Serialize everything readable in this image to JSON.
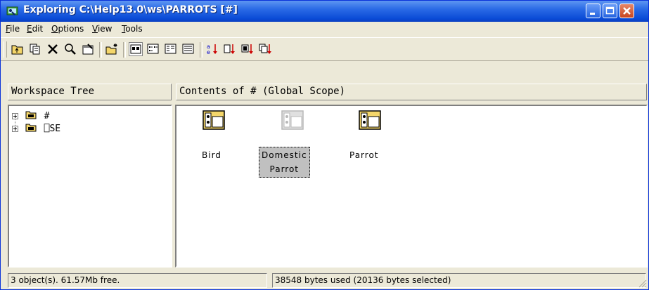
{
  "window": {
    "title": "Exploring C:\\Help13.0\\ws\\PARROTS [#]"
  },
  "menu": [
    {
      "label_pre": "",
      "mnemonic": "F",
      "label_post": "ile"
    },
    {
      "label_pre": "",
      "mnemonic": "E",
      "label_post": "dit"
    },
    {
      "label_pre": "",
      "mnemonic": "O",
      "label_post": "ptions"
    },
    {
      "label_pre": "",
      "mnemonic": "V",
      "label_post": "iew"
    },
    {
      "label_pre": "",
      "mnemonic": "T",
      "label_post": "ools"
    }
  ],
  "toolbar_icons": [
    "up-folder-icon",
    "copy-icon",
    "delete-icon",
    "search-icon",
    "properties-icon",
    "new-folder-icon",
    "large-icons-view-icon",
    "small-icons-view-icon",
    "list-view-icon",
    "details-view-icon",
    "sort-by-name-icon",
    "sort-by-type-icon",
    "sort-by-size-icon",
    "sort-by-date-icon"
  ],
  "left_pane": {
    "header": "Workspace Tree",
    "items": [
      {
        "label": "#"
      },
      {
        "label": "⎕SE"
      }
    ]
  },
  "right_pane": {
    "header": "Contents of # (Global Scope)",
    "objects": [
      {
        "line1": "Bird",
        "line2": "",
        "selected": false
      },
      {
        "line1": "Domestic",
        "line2": "Parrot",
        "selected": true
      },
      {
        "line1": "Parrot",
        "line2": "",
        "selected": false
      }
    ]
  },
  "status": {
    "left": "3 object(s). 61.57Mb free.",
    "right": "38548 bytes used (20136 bytes selected)"
  },
  "colors": {
    "titlebar": "#0a4bd6",
    "close_button": "#c7451f",
    "class_icon": "#f4d66a",
    "selection": "#c0c0c0"
  }
}
